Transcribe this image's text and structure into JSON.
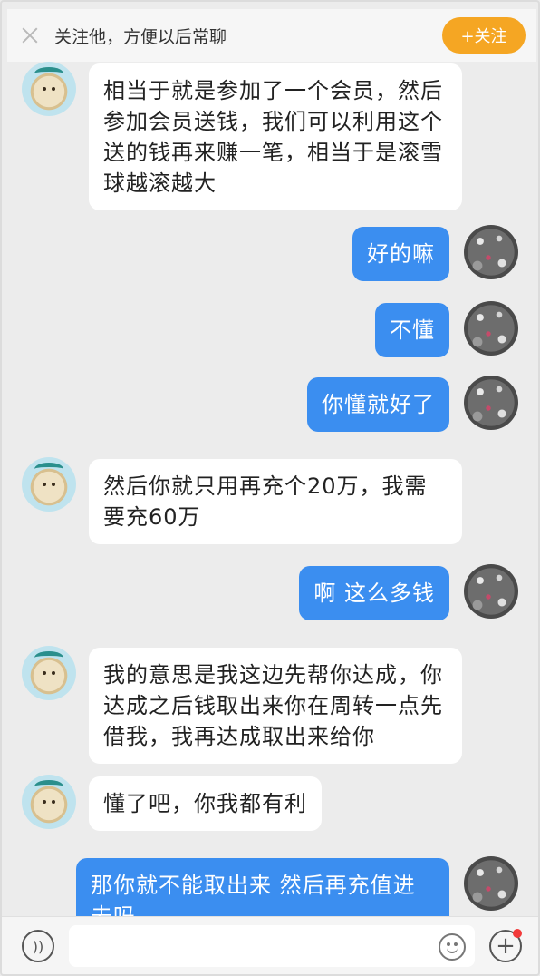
{
  "follow_bar": {
    "close_icon": "close-icon",
    "text": "关注他，方便以后常聊",
    "follow_label": "+关注",
    "follow_color": "#f5a623"
  },
  "messages": [
    {
      "side": "left",
      "text": "相当于就是参加了一个会员，然后参加会员送钱，我们可以利用这个送的钱再来赚一笔，相当于是滚雪球越滚越大"
    },
    {
      "side": "right",
      "text": "好的嘛"
    },
    {
      "side": "right",
      "text": "不懂"
    },
    {
      "side": "right",
      "text": "你懂就好了"
    },
    {
      "side": "left",
      "text": "然后你就只用再充个20万，我需要充60万"
    },
    {
      "side": "right",
      "text": "啊 这么多钱"
    },
    {
      "side": "left",
      "text": "我的意思是我这边先帮你达成，你达成之后钱取出来你在周转一点先借我，我再达成取出来给你"
    },
    {
      "side": "left",
      "text": "懂了吧，你我都有利"
    },
    {
      "side": "right",
      "text": "那你就不能取出来 然后再充值进去吗"
    }
  ],
  "input_bar": {
    "voice_icon": "voice-icon",
    "emoji_icon": "emoji-icon",
    "plus_icon": "plus-icon",
    "has_notification_dot": true
  },
  "colors": {
    "sent_bubble": "#3b8ef0",
    "received_bubble": "#ffffff",
    "background": "#ececec"
  }
}
